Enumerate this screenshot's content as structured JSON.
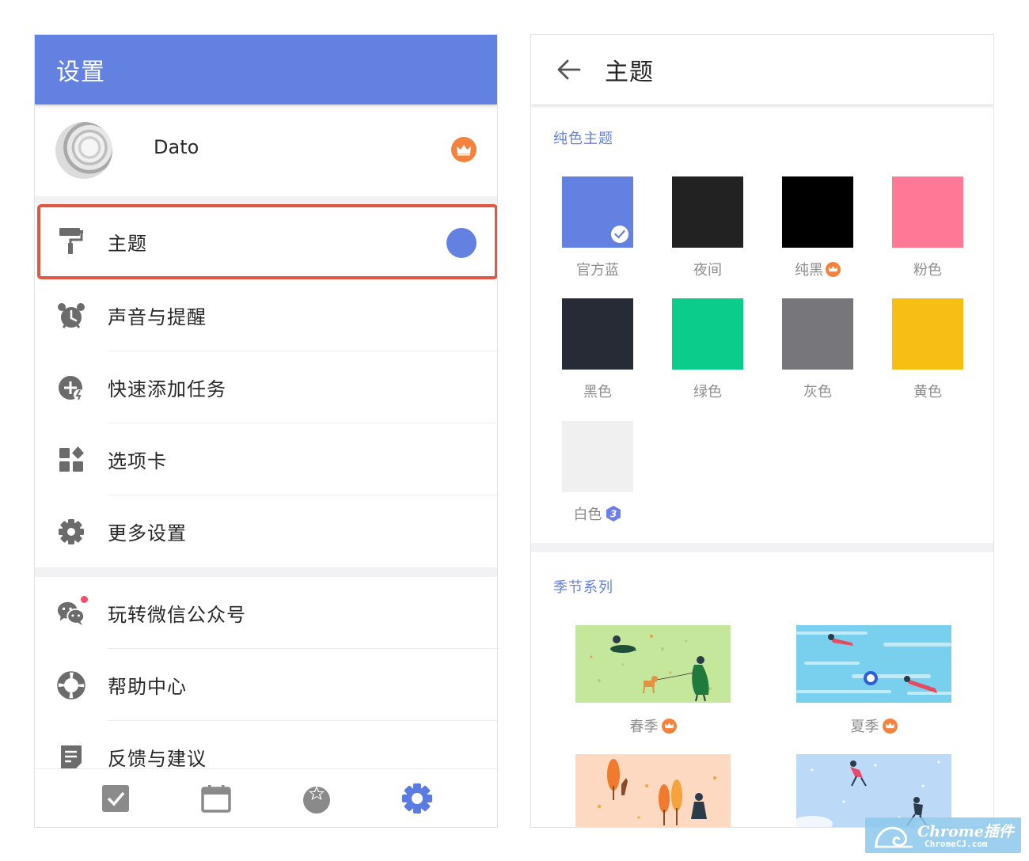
{
  "settings": {
    "header_title": "设置",
    "profile_name": "Dato",
    "menu": {
      "theme": "主题",
      "sound": "声音与提醒",
      "quick_add": "快速添加任务",
      "tabs": "选项卡",
      "more": "更多设置",
      "wechat": "玩转微信公众号",
      "help": "帮助中心",
      "feedback": "反馈与建议"
    },
    "theme_dot_color": "#6381e0",
    "nav_icons": [
      "checkbox-icon",
      "calendar-icon",
      "pomodoro-icon",
      "settings-gear-icon"
    ]
  },
  "theme_page": {
    "header_title": "主题",
    "solid_section_title": "纯色主题",
    "solid_themes": [
      {
        "label": "官方蓝",
        "color": "#6381e0",
        "selected": true
      },
      {
        "label": "夜间",
        "color": "#222222"
      },
      {
        "label": "纯黑",
        "color": "#000000",
        "premium": true
      },
      {
        "label": "粉色",
        "color": "#ff7896"
      },
      {
        "label": "黑色",
        "color": "#272b35"
      },
      {
        "label": "绿色",
        "color": "#0bcc8b"
      },
      {
        "label": "灰色",
        "color": "#77777b"
      },
      {
        "label": "黄色",
        "color": "#f7be14"
      },
      {
        "label": "白色",
        "color": "#f0f0f0",
        "level": "3"
      }
    ],
    "season_section_title": "季节系列",
    "seasons": [
      {
        "label": "春季",
        "premium": true
      },
      {
        "label": "夏季",
        "premium": true
      }
    ]
  },
  "watermark": {
    "title": "Chrome插件",
    "subtitle": "ChromeCJ.com"
  }
}
